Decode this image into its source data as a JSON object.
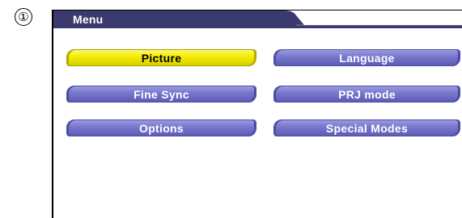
{
  "step": {
    "marker": "①"
  },
  "menu": {
    "tab_label": "Menu",
    "buttons": [
      {
        "label": "Picture",
        "state": "selected"
      },
      {
        "label": "Language",
        "state": "normal"
      },
      {
        "label": "Fine Sync",
        "state": "normal"
      },
      {
        "label": "PRJ mode",
        "state": "normal"
      },
      {
        "label": "Options",
        "state": "normal"
      },
      {
        "label": "Special Modes",
        "state": "normal"
      }
    ]
  },
  "colors": {
    "tab": "#3a3a6e",
    "button_normal": "#7676cc",
    "button_selected": "#f2ea00"
  }
}
